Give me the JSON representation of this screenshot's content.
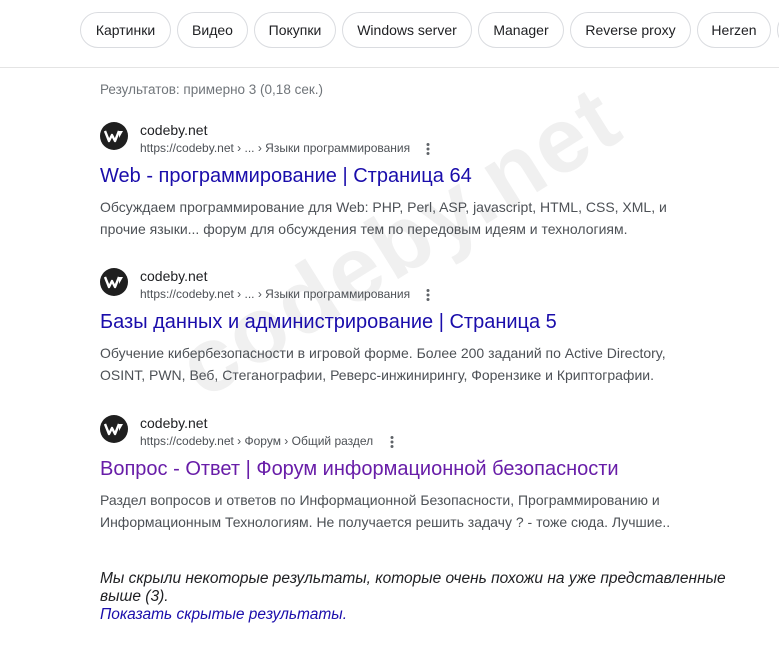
{
  "chips": [
    {
      "label": "Картинки"
    },
    {
      "label": "Видео"
    },
    {
      "label": "Покупки"
    },
    {
      "label": "Windows server"
    },
    {
      "label": "Manager"
    },
    {
      "label": "Reverse proxy"
    },
    {
      "label": "Herzen"
    },
    {
      "label": ""
    }
  ],
  "stats": "Результатов: примерно 3 (0,18 сек.)",
  "results": [
    {
      "site": "codeby.net",
      "breadcrumb": "https://codeby.net › ... › Языки программирования",
      "title": "Web - программирование | Страница 64",
      "snippet": "Обсуждаем программирование для Web: PHP, Perl, ASP, javascript, HTML, CSS, XML, и прочие языки... форум для обсуждения тем по передовым идеям и технологиям."
    },
    {
      "site": "codeby.net",
      "breadcrumb": "https://codeby.net › ... › Языки программирования",
      "title": "Базы данных и администрирование | Страница 5",
      "snippet": "Обучение кибербезопасности в игровой форме. Более 200 заданий по Active Directory, OSINT, PWN, Веб, Стеганографии, Реверс-инжинирингу, Форензике и Криптографии."
    },
    {
      "site": "codeby.net",
      "breadcrumb": "https://codeby.net › Форум › Общий раздел",
      "title": "Вопрос - Ответ | Форум информационной безопасности",
      "snippet": "Раздел вопросов и ответов по Информационной Безопасности, Программированию и Информационным Технологиям. Не получается решить задачу ? - тоже сюда. Лучшие.."
    }
  ],
  "omitted": {
    "text": "Мы скрыли некоторые результаты, которые очень похожи на уже представленные выше (3).",
    "link": "Показать скрытые результаты."
  },
  "watermark": "codeby.net",
  "colors": {
    "link": "#1a0dab",
    "visited": "#681da8",
    "snippet": "#4d5156"
  }
}
